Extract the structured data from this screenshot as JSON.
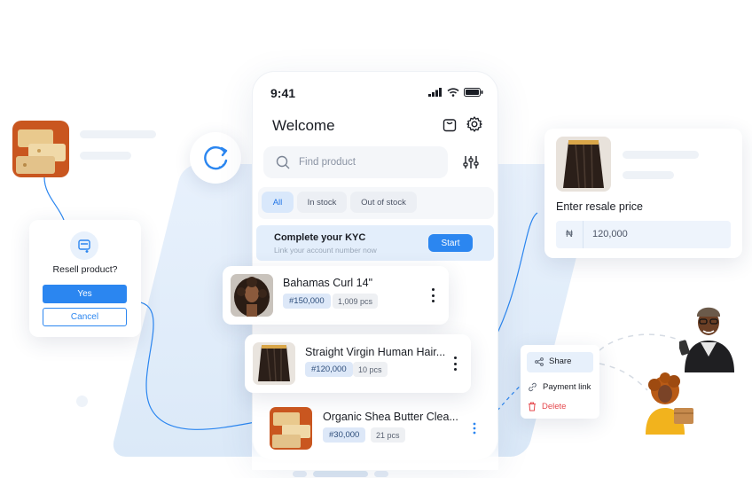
{
  "phone": {
    "time": "9:41",
    "welcome": "Welcome",
    "search": {
      "placeholder": "Find product"
    },
    "chips": [
      "All",
      "In stock",
      "Out of stock"
    ],
    "active_chip": "All",
    "kyc": {
      "title": "Complete your KYC",
      "subtitle": "Link your account number now",
      "button": "Start"
    }
  },
  "products": [
    {
      "name": "Bahamas Curl 14\"",
      "price": "#150,000",
      "qty": "1,009 pcs"
    },
    {
      "name": "Straight Virgin Human Hair...",
      "price": "#120,000",
      "qty": "10 pcs"
    },
    {
      "name": "Organic Shea Butter Clea...",
      "price": "#30,000",
      "qty": "21 pcs"
    }
  ],
  "resell_dialog": {
    "question": "Resell product?",
    "yes": "Yes",
    "cancel": "Cancel"
  },
  "resale_price": {
    "label": "Enter resale price",
    "currency": "₦",
    "value": "120,000"
  },
  "context_menu": {
    "share": "Share",
    "payment_link": "Payment link",
    "delete": "Delete"
  },
  "colors": {
    "accent": "#2b86f0",
    "danger": "#e5484d",
    "light_blue": "#e3eefb"
  }
}
